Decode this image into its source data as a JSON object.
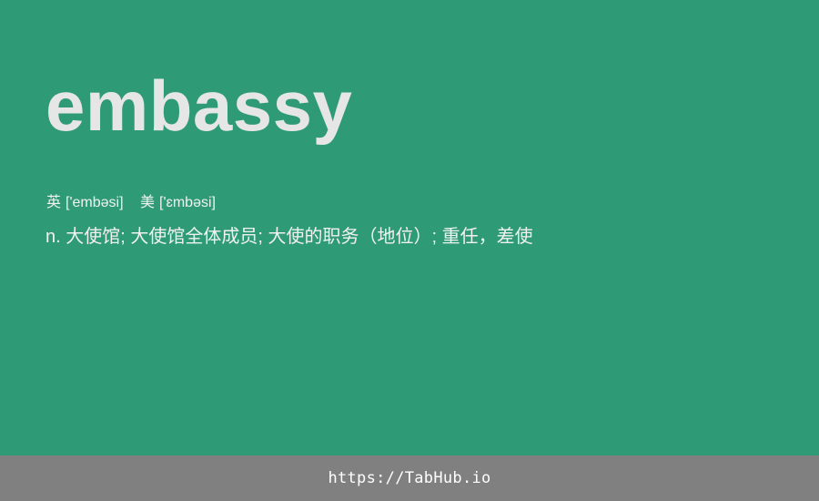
{
  "entry": {
    "word": "embassy",
    "phonetics": {
      "uk_label": "英",
      "uk_ipa": "['embəsi]",
      "us_label": "美",
      "us_ipa": "['ɛmbəsi]"
    },
    "definition": "n. 大使馆; 大使馆全体成员; 大使的职务（地位）; 重任，差使"
  },
  "footer": {
    "link_text": "https://TabHub.io"
  },
  "colors": {
    "background": "#2e9b76",
    "footer_background": "#808080",
    "word_text": "#e6e6e6",
    "body_text": "#f1f1f1"
  }
}
